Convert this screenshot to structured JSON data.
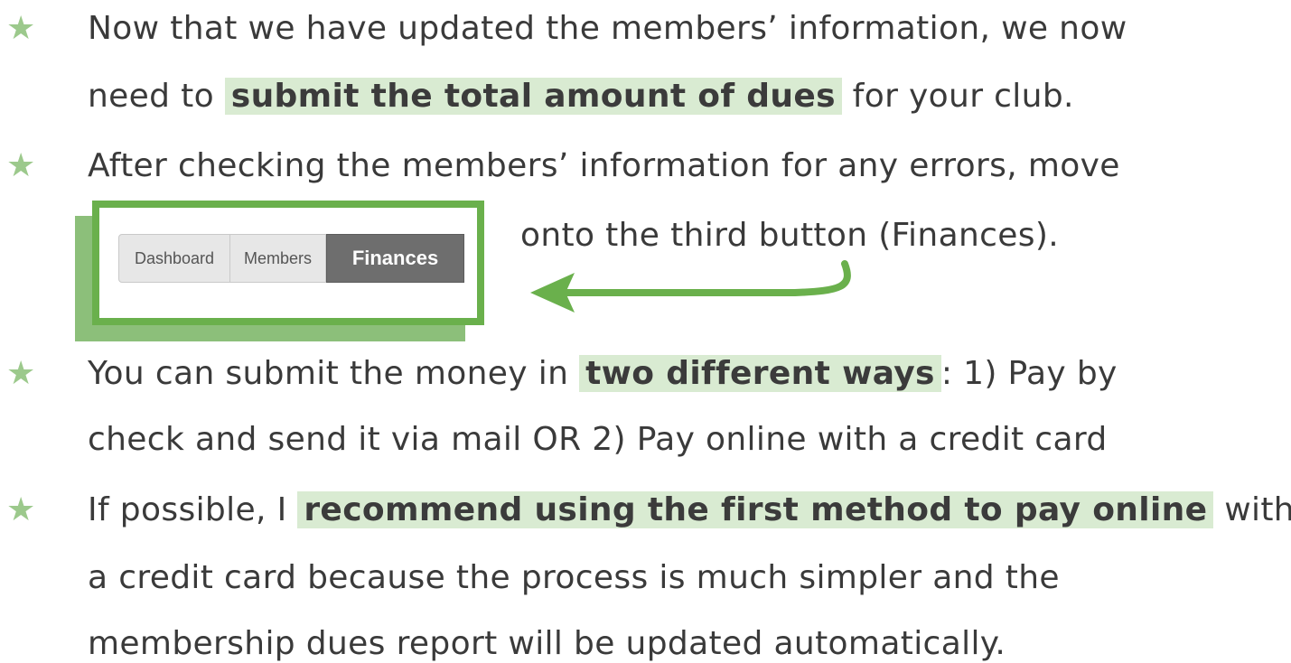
{
  "bullets": [
    {
      "icon": "star-icon",
      "lines": [
        {
          "before": "Now that we have updated the members’ information, we now"
        },
        {
          "before": "need to ",
          "highlight": "submit the total amount of dues",
          "after": " for your club."
        }
      ]
    },
    {
      "icon": "star-icon",
      "lines": [
        {
          "before": "After checking the members’ information for any errors, move"
        },
        {
          "before": "onto the third button (Finances)."
        }
      ]
    },
    {
      "icon": "star-icon",
      "lines": [
        {
          "before": "You can submit the money in ",
          "highlight": "two different ways",
          "after": ": 1) Pay by"
        },
        {
          "before": "check and send it via mail OR 2) Pay online with a credit card"
        }
      ]
    },
    {
      "icon": "star-icon",
      "lines": [
        {
          "before": "If possible, I ",
          "highlight": "recommend using the first method to pay online",
          "after": " with"
        },
        {
          "before": "a credit card because the process is much simpler and the"
        },
        {
          "before": "membership dues report will be updated automatically."
        }
      ]
    }
  ],
  "nav": {
    "dashboard": "Dashboard",
    "members": "Members",
    "finances": "Finances"
  },
  "colors": {
    "star": "#9cc98c",
    "highlight": "#d9ebd2",
    "frame": "#6ab04c",
    "frame_shadow": "#8cbf7a",
    "arrow": "#6ab04c"
  }
}
